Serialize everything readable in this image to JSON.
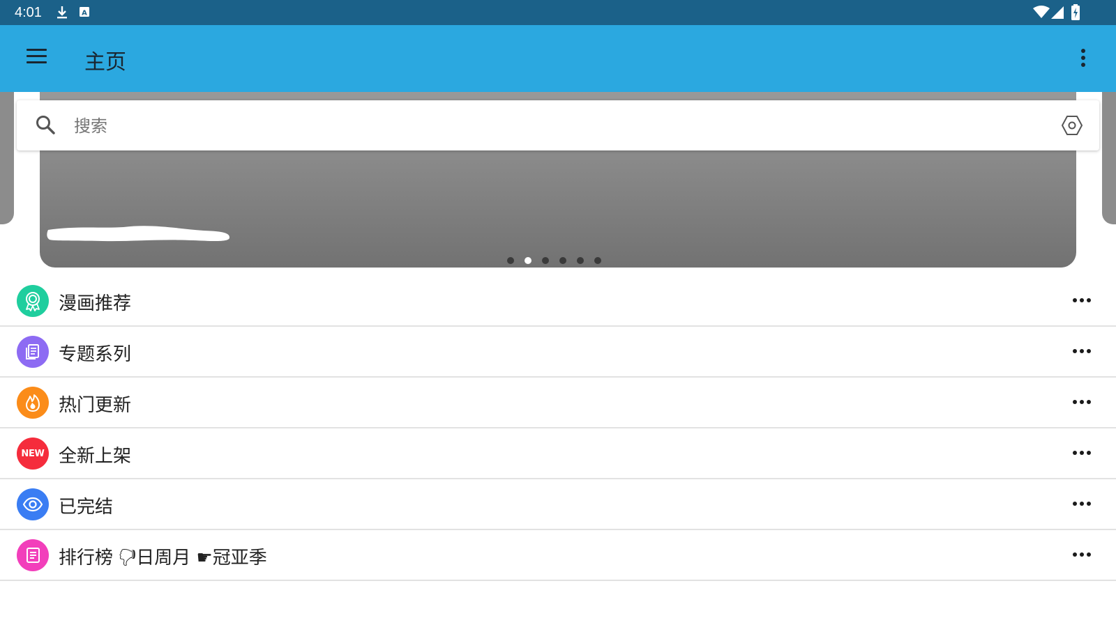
{
  "status_bar": {
    "time": "4:01",
    "left_icons": [
      "download-icon",
      "a-notification-icon"
    ],
    "right_icons": [
      "wifi-icon",
      "signal-icon",
      "battery-charging-icon"
    ],
    "background": "#1b6189"
  },
  "app_bar": {
    "title": "主页",
    "background": "#2ba8e0",
    "menu_icon": "hamburger-menu-icon",
    "overflow_icon": "more-vertical-icon"
  },
  "search": {
    "placeholder": "搜索",
    "value": "",
    "search_icon": "search-icon",
    "settings_icon": "hexagon-settings-icon"
  },
  "carousel": {
    "slide_count": 6,
    "active_index": 1
  },
  "list": {
    "items": [
      {
        "label": "漫画推荐",
        "icon": "award-icon",
        "color": "#1fce9e"
      },
      {
        "label": "专题系列",
        "icon": "document-icon",
        "color": "#8d6bf3"
      },
      {
        "label": "热门更新",
        "icon": "flame-icon",
        "color": "#fb8c19"
      },
      {
        "label": "全新上架",
        "icon": "new-badge-icon",
        "icon_text": "NEW",
        "color": "#f52c3c"
      },
      {
        "label": "已完结",
        "icon": "eye-icon",
        "color": "#3a7df3"
      },
      {
        "label": "排行榜 🖓日周月 ☛冠亚季",
        "icon": "ranking-list-icon",
        "color": "#f23fbb"
      }
    ],
    "more_icon": "more-horizontal-icon"
  }
}
